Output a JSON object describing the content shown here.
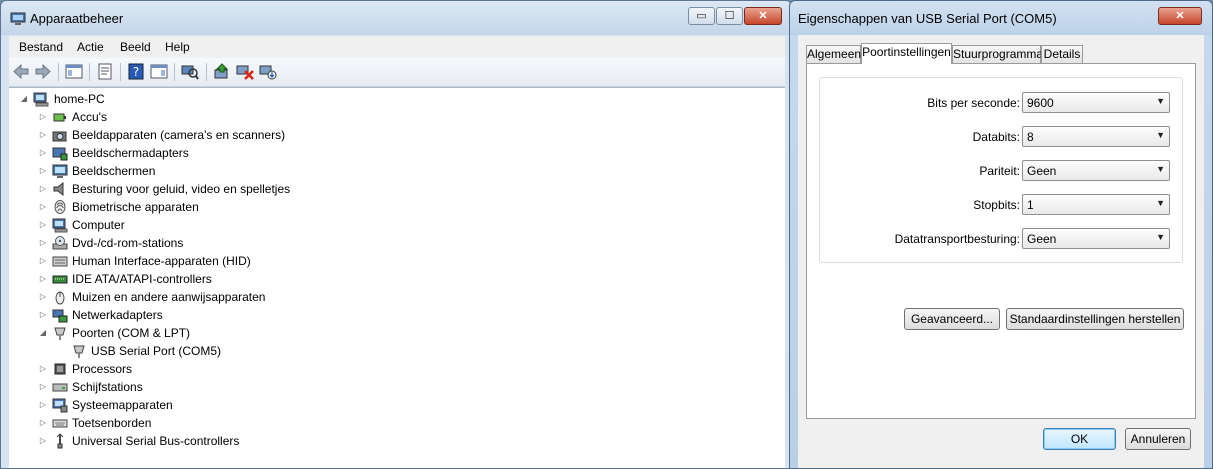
{
  "device_manager": {
    "title": "Apparaatbeheer",
    "menu": [
      "Bestand",
      "Actie",
      "Beeld",
      "Help"
    ],
    "window_controls": {
      "minimize": "▭",
      "maximize": "☐",
      "close": "✕"
    },
    "tree": {
      "root": "home-PC",
      "categories": [
        {
          "label": "Accu's",
          "icon": "battery-icon"
        },
        {
          "label": "Beeldapparaten (camera's en scanners)",
          "icon": "camera-icon"
        },
        {
          "label": "Beeldschermadapters",
          "icon": "display-adapter-icon"
        },
        {
          "label": "Beeldschermen",
          "icon": "monitor-icon"
        },
        {
          "label": "Besturing voor geluid, video en spelletjes",
          "icon": "speaker-icon"
        },
        {
          "label": "Biometrische apparaten",
          "icon": "fingerprint-icon"
        },
        {
          "label": "Computer",
          "icon": "computer-icon"
        },
        {
          "label": "Dvd-/cd-rom-stations",
          "icon": "disc-drive-icon"
        },
        {
          "label": "Human Interface-apparaten (HID)",
          "icon": "hid-icon"
        },
        {
          "label": "IDE ATA/ATAPI-controllers",
          "icon": "ide-controller-icon"
        },
        {
          "label": "Muizen en andere aanwijsapparaten",
          "icon": "mouse-icon"
        },
        {
          "label": "Netwerkadapters",
          "icon": "network-adapter-icon"
        },
        {
          "label": "Poorten (COM & LPT)",
          "icon": "port-icon",
          "expanded": true,
          "children": [
            {
              "label": "USB Serial Port (COM5)",
              "icon": "port-icon"
            }
          ]
        },
        {
          "label": "Processors",
          "icon": "processor-icon"
        },
        {
          "label": "Schijfstations",
          "icon": "disk-drive-icon"
        },
        {
          "label": "Systeemapparaten",
          "icon": "system-device-icon"
        },
        {
          "label": "Toetsenborden",
          "icon": "keyboard-icon"
        },
        {
          "label": "Universal Serial Bus-controllers",
          "icon": "usb-icon"
        }
      ]
    }
  },
  "properties_dialog": {
    "title": "Eigenschappen van USB Serial Port (COM5)",
    "close": "✕",
    "tabs": [
      "Algemeen",
      "Poortinstellingen",
      "Stuurprogramma",
      "Details"
    ],
    "active_tab": "Poortinstellingen",
    "fields": [
      {
        "label": "Bits per seconde:",
        "value": "9600"
      },
      {
        "label": "Databits:",
        "value": "8"
      },
      {
        "label": "Pariteit:",
        "value": "Geen"
      },
      {
        "label": "Stopbits:",
        "value": "1"
      },
      {
        "label": "Datatransportbesturing:",
        "value": "Geen"
      }
    ],
    "advanced_button": "Geavanceerd...",
    "restore_button": "Standaardinstellingen herstellen",
    "ok_button": "OK",
    "cancel_button": "Annuleren"
  },
  "colors": {
    "title_bar": "#c4d6ea",
    "close_button": "#c7452b",
    "default_button": "#bee6fd"
  }
}
